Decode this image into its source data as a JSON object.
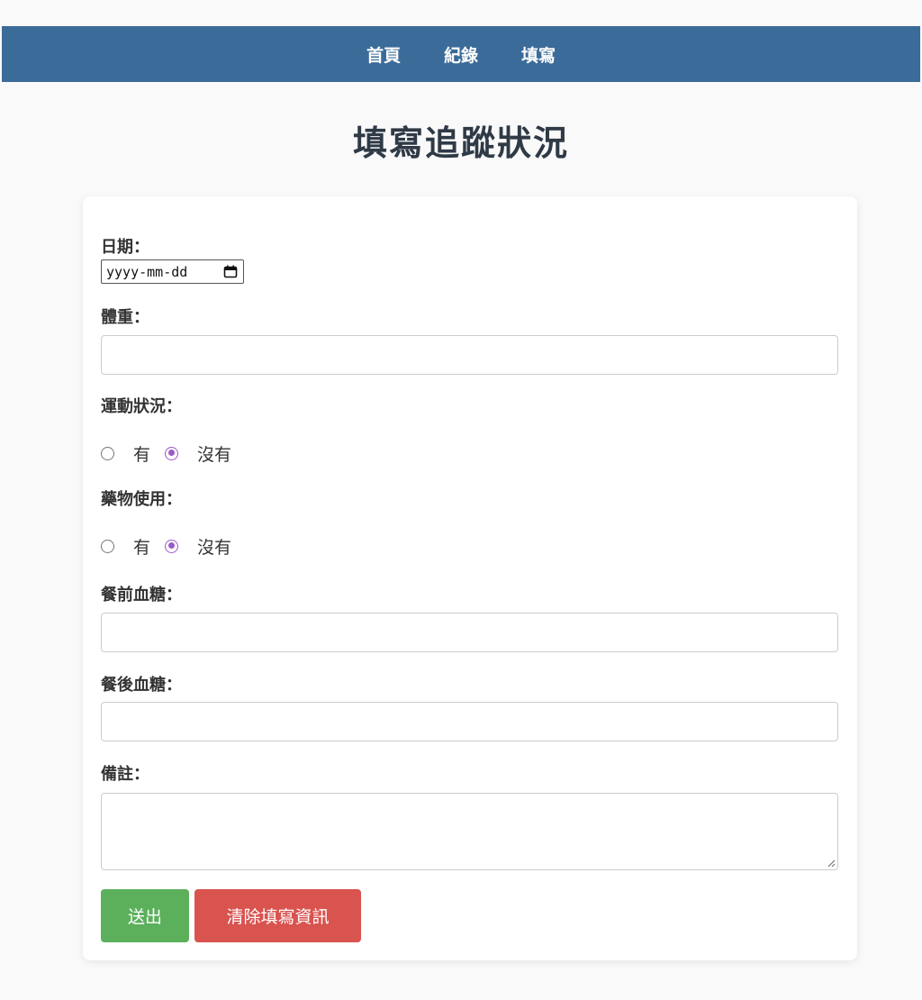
{
  "nav": {
    "items": [
      "首頁",
      "紀錄",
      "填寫"
    ]
  },
  "page_title": "填寫追蹤狀況",
  "form": {
    "date_label": "日期：",
    "date_placeholder": "yyyy-mm-dd",
    "weight_label": "體重：",
    "weight_value": "",
    "exercise_label": "運動狀況：",
    "exercise_options": [
      "有",
      "沒有"
    ],
    "exercise_selected": "沒有",
    "medication_label": "藥物使用：",
    "medication_options": [
      "有",
      "沒有"
    ],
    "medication_selected": "沒有",
    "pre_meal_label": "餐前血糖：",
    "pre_meal_value": "",
    "post_meal_label": "餐後血糖：",
    "post_meal_value": "",
    "notes_label": "備註：",
    "notes_value": "",
    "submit_label": "送出",
    "clear_label": "清除填寫資訊"
  },
  "colors": {
    "navbar": "#3b6b99",
    "radio_accent": "#9b59c8",
    "submit": "#5cb05c",
    "clear": "#d9534f"
  },
  "icons": {
    "date": "calendar-icon",
    "textarea_resize": "resize-handle-icon"
  }
}
